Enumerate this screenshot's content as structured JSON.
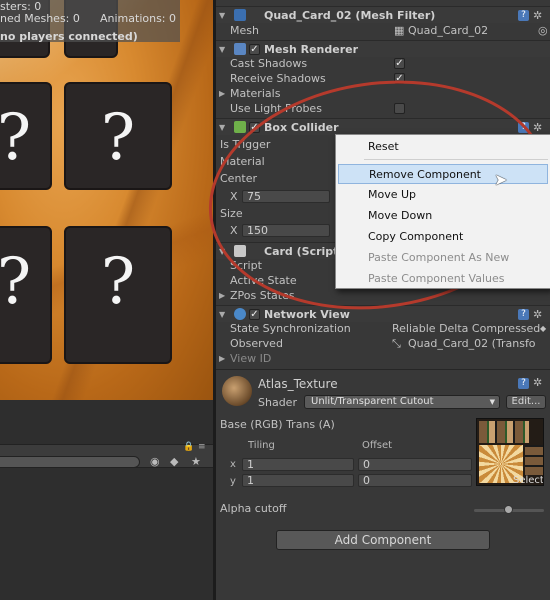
{
  "game_view": {
    "stats": {
      "line1": "sters: 0",
      "line2_a": "ned Meshes: 0",
      "line2_b": "Animations: 0",
      "line3": "no players connected)"
    },
    "card_symbol": "?"
  },
  "inspector": {
    "mesh_filter": {
      "title": "Quad_Card_02 (Mesh Filter)",
      "mesh_label": "Mesh",
      "mesh_value": "Quad_Card_02"
    },
    "mesh_renderer": {
      "title": "Mesh Renderer",
      "enabled": true,
      "cast_shadows_label": "Cast Shadows",
      "cast_shadows": true,
      "receive_shadows_label": "Receive Shadows",
      "receive_shadows": true,
      "materials_label": "Materials",
      "light_probes_label": "Use Light Probes",
      "light_probes": false
    },
    "box_collider": {
      "title": "Box Collider",
      "enabled": true,
      "is_trigger_label": "Is Trigger",
      "material_label": "Material",
      "center_label": "Center",
      "center_x_label": "X",
      "center_x": "75",
      "size_label": "Size",
      "size_x_label": "X",
      "size_x": "150"
    },
    "card_script": {
      "title": "Card (Script",
      "script_label": "Script",
      "active_state_label": "Active State",
      "zpos_label": "ZPos States"
    },
    "network_view": {
      "title": "Network View",
      "enabled": true,
      "state_sync_label": "State Synchronization",
      "state_sync_value": "Reliable Delta Compressed",
      "observed_label": "Observed",
      "observed_value": "Quad_Card_02 (Transfo",
      "view_id_label": "View ID"
    },
    "material": {
      "name": "Atlas_Texture",
      "shader_label": "Shader",
      "shader_value": "Unlit/Transparent Cutout",
      "edit_label": "Edit...",
      "base_label": "Base (RGB) Trans (A)",
      "tiling_label": "Tiling",
      "offset_label": "Offset",
      "x_label": "x",
      "y_label": "y",
      "tiling_x": "1",
      "tiling_y": "1",
      "offset_x": "0",
      "offset_y": "0",
      "select_label": "Select",
      "alpha_label": "Alpha cutoff",
      "alpha_value": 0.5
    },
    "add_component_label": "Add Component"
  },
  "context_menu": {
    "items": [
      {
        "label": "Reset",
        "enabled": true,
        "highlighted": false
      },
      {
        "label": "Remove Component",
        "enabled": true,
        "highlighted": true
      },
      {
        "label": "Move Up",
        "enabled": true,
        "highlighted": false
      },
      {
        "label": "Move Down",
        "enabled": true,
        "highlighted": false
      },
      {
        "label": "Copy Component",
        "enabled": true,
        "highlighted": false
      },
      {
        "label": "Paste Component As New",
        "enabled": false,
        "highlighted": false
      },
      {
        "label": "Paste Component Values",
        "enabled": false,
        "highlighted": false
      }
    ]
  },
  "colors": {
    "annotation": "#b53a2c",
    "menu_highlight": "#cde2f6",
    "help_icon": "#4a78b8"
  },
  "icons": {
    "help": "?",
    "gear": "✲",
    "check": "✓",
    "fold_open": "▼",
    "fold_closed": "▶"
  }
}
